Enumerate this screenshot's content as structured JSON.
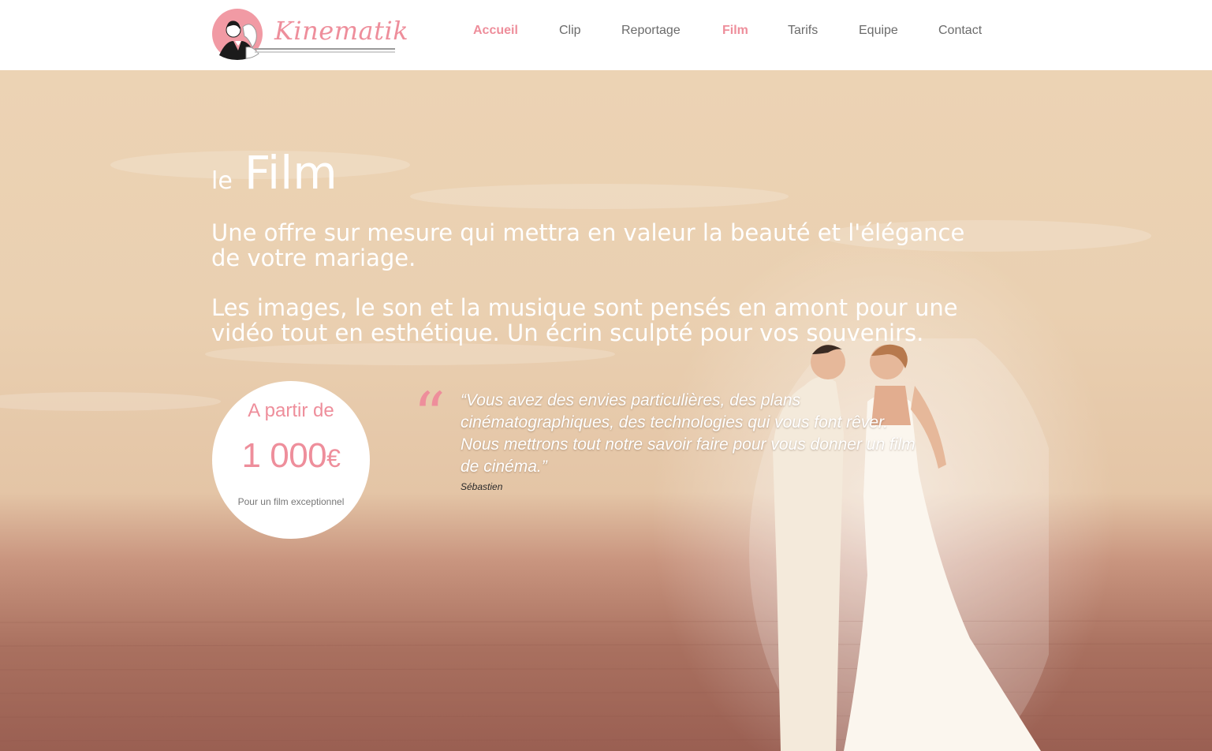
{
  "logo": {
    "text": "Kinematik"
  },
  "nav": {
    "items": [
      {
        "label": "Accueil"
      },
      {
        "label": "Clip"
      },
      {
        "label": "Reportage"
      },
      {
        "label": "Film"
      },
      {
        "label": "Tarifs"
      },
      {
        "label": "Equipe"
      },
      {
        "label": "Contact"
      }
    ]
  },
  "hero": {
    "title_small": "le",
    "title_big": "Film",
    "paragraph_1": "Une offre sur mesure qui mettra en valeur la beauté et l'élégance de votre mariage.",
    "paragraph_2": "Les images, le son et la musique sont pensés en amont pour une vidéo tout en esthétique. Un écrin sculpté pour vos souvenirs."
  },
  "price": {
    "top": "A partir de",
    "amount": "1 000",
    "currency": "€",
    "sub": "Pour un film exceptionnel"
  },
  "quote": {
    "mark": "“",
    "text": "“Vous avez des envies particulières, des plans cinématographiques, des technologies qui vous font rêver. Nous mettrons tout notre savoir faire pour vous donner un film de cinéma.”",
    "author": "Sébastien"
  },
  "colors": {
    "accent": "#ee8e9b",
    "nav_text": "#6b6b6b",
    "hero_text": "#ffffff"
  }
}
